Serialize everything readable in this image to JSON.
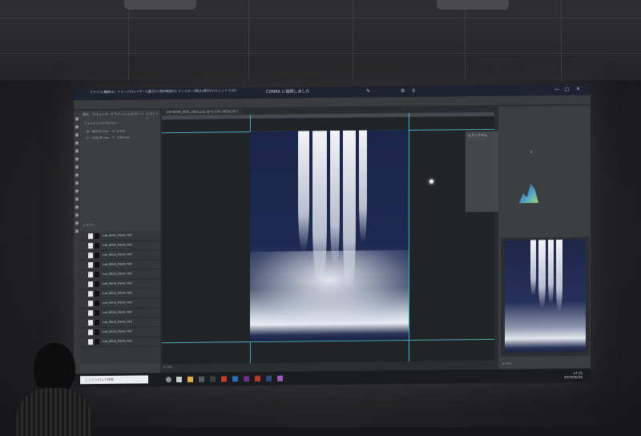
{
  "scene": {
    "description_colors": {
      "wall": "#2b2b2d",
      "screen_accent": "#4fc3d8",
      "artwork_sky": "#1e2a52"
    }
  },
  "app": {
    "menu": [
      "ファイル(F)",
      "編集(E)",
      "イメージ(I)",
      "レイヤー(L)",
      "書式(Y)",
      "選択範囲(S)",
      "フィルター(T)",
      "3D(D)",
      "表示(V)",
      "ウィンドウ(W)"
    ],
    "notification": "CONRA に接続しました",
    "document_tab": "0978098_吹流_16bit.psb @ 8.33% (RGB/16*)",
    "left_tabs": [
      "属性",
      "スウォッチ",
      "グラデーション",
      "パターン",
      "ヒストリー"
    ],
    "properties_title": "ドキュメントのプロパティ",
    "property_values": [
      "W : 896.07 mm",
      "X : 4 mm",
      "H : 1280.00 mm",
      "Y : 1256 mm"
    ],
    "layers_tab": "レイヤー",
    "layers": [
      "Lab_0B05_PSHG.TIFF",
      "Lab_0B05_PSHG.TIFF",
      "Lab_0B10_PSHG.TIFF",
      "Lab_0B10_PSHG.TIFF",
      "Lab_0B10_PSHG.TIFF",
      "Lab_0B10_PSHG.TIFF",
      "Lab_0B10_PSHG.TIFF",
      "Lab_0B10_PSHG.TIFF",
      "Lab_0B10_PSHG.TIFF",
      "Lab_0B10_PSHG.TIFF",
      "Lab_0B10_PSHG.TIFF",
      "Lab_0B10_PSHG.TIFF"
    ],
    "histogram_title": "ヒストグラム",
    "zoom_left": "8.33%",
    "zoom_right": "8.33%",
    "search_placeholder": "ここに入力して検索",
    "clock_time": "14:35",
    "clock_date": "2019/06/26"
  }
}
